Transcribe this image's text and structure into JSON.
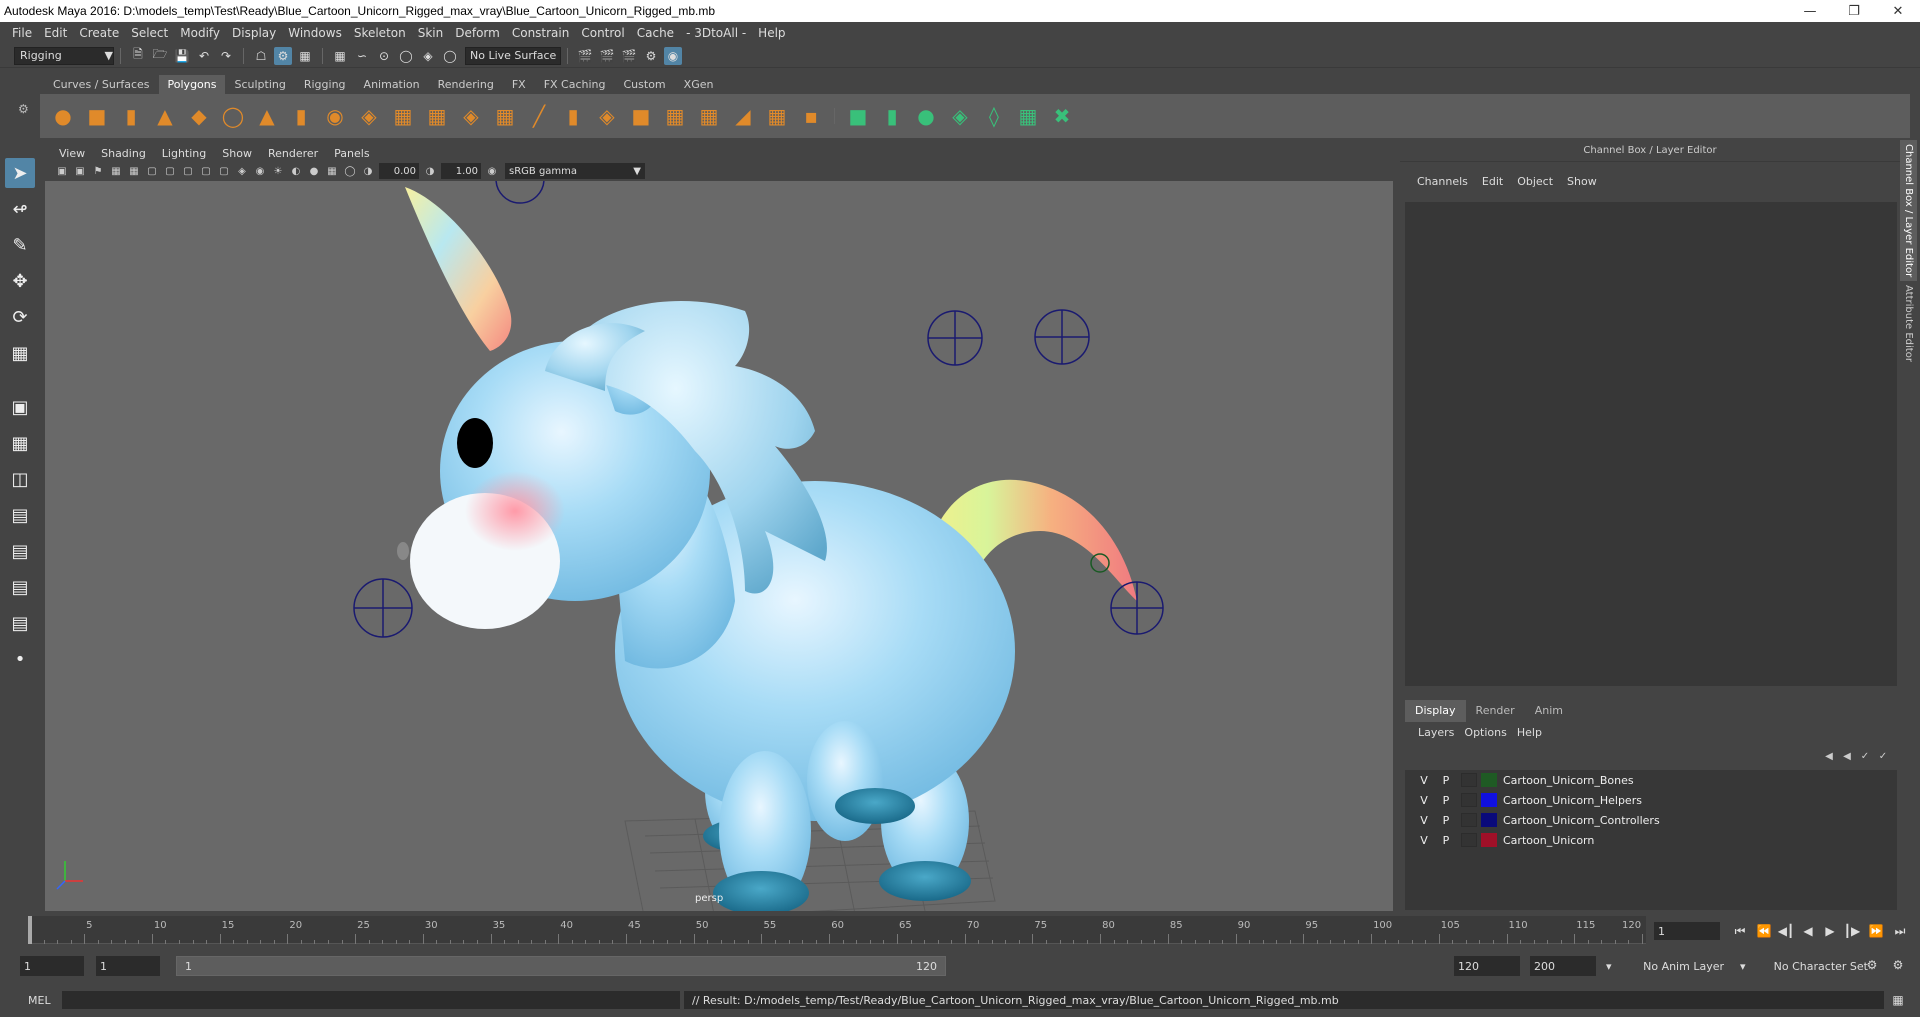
{
  "window": {
    "title": "Autodesk Maya 2016: D:\\models_temp\\Test\\Ready\\Blue_Cartoon_Unicorn_Rigged_max_vray\\Blue_Cartoon_Unicorn_Rigged_mb.mb"
  },
  "menu": [
    "File",
    "Edit",
    "Create",
    "Select",
    "Modify",
    "Display",
    "Windows",
    "Skeleton",
    "Skin",
    "Deform",
    "Constrain",
    "Control",
    "Cache",
    "- 3DtoAll -",
    "Help"
  ],
  "status": {
    "mode": "Rigging",
    "live_surface": "No Live Surface"
  },
  "shelf": {
    "tabs": [
      "Curves / Surfaces",
      "Polygons",
      "Sculpting",
      "Rigging",
      "Animation",
      "Rendering",
      "FX",
      "FX Caching",
      "Custom",
      "XGen"
    ],
    "active": "Polygons"
  },
  "viewport": {
    "menu": [
      "View",
      "Shading",
      "Lighting",
      "Show",
      "Renderer",
      "Panels"
    ],
    "exposure": "0.00",
    "gamma": "1.00",
    "color_space": "sRGB gamma",
    "camera": "persp"
  },
  "channel_box": {
    "title": "Channel Box / Layer Editor",
    "menu": [
      "Channels",
      "Edit",
      "Object",
      "Show"
    ]
  },
  "layer_editor": {
    "tabs": [
      "Display",
      "Render",
      "Anim"
    ],
    "menu": [
      "Layers",
      "Options",
      "Help"
    ],
    "layers": [
      {
        "v": "V",
        "p": "P",
        "name": "Cartoon_Unicorn_Bones",
        "color": "#1f5a24"
      },
      {
        "v": "V",
        "p": "P",
        "name": "Cartoon_Unicorn_Helpers",
        "color": "#1010e0"
      },
      {
        "v": "V",
        "p": "P",
        "name": "Cartoon_Unicorn_Controllers",
        "color": "#0a0a7a"
      },
      {
        "v": "V",
        "p": "P",
        "name": "Cartoon_Unicorn",
        "color": "#a01028"
      }
    ]
  },
  "side_tabs": [
    "Channel Box / Layer Editor",
    "Attribute Editor"
  ],
  "timeline": {
    "labels": [
      "5",
      "10",
      "15",
      "20",
      "25",
      "30",
      "35",
      "40",
      "45",
      "50",
      "55",
      "60",
      "65",
      "70",
      "75",
      "80",
      "85",
      "90",
      "95",
      "100",
      "105",
      "110",
      "115",
      "120"
    ],
    "current_frame": "1"
  },
  "range": {
    "start": "1",
    "playback_start": "1",
    "slider_start": "1",
    "slider_end": "120",
    "playback_end": "120",
    "end": "200",
    "anim_layer": "No Anim Layer",
    "char_set": "No Character Set"
  },
  "command": {
    "lang": "MEL",
    "result": "// Result: D:/models_temp/Test/Ready/Blue_Cartoon_Unicorn_Rigged_max_vray/Blue_Cartoon_Unicorn_Rigged_mb.mb"
  }
}
